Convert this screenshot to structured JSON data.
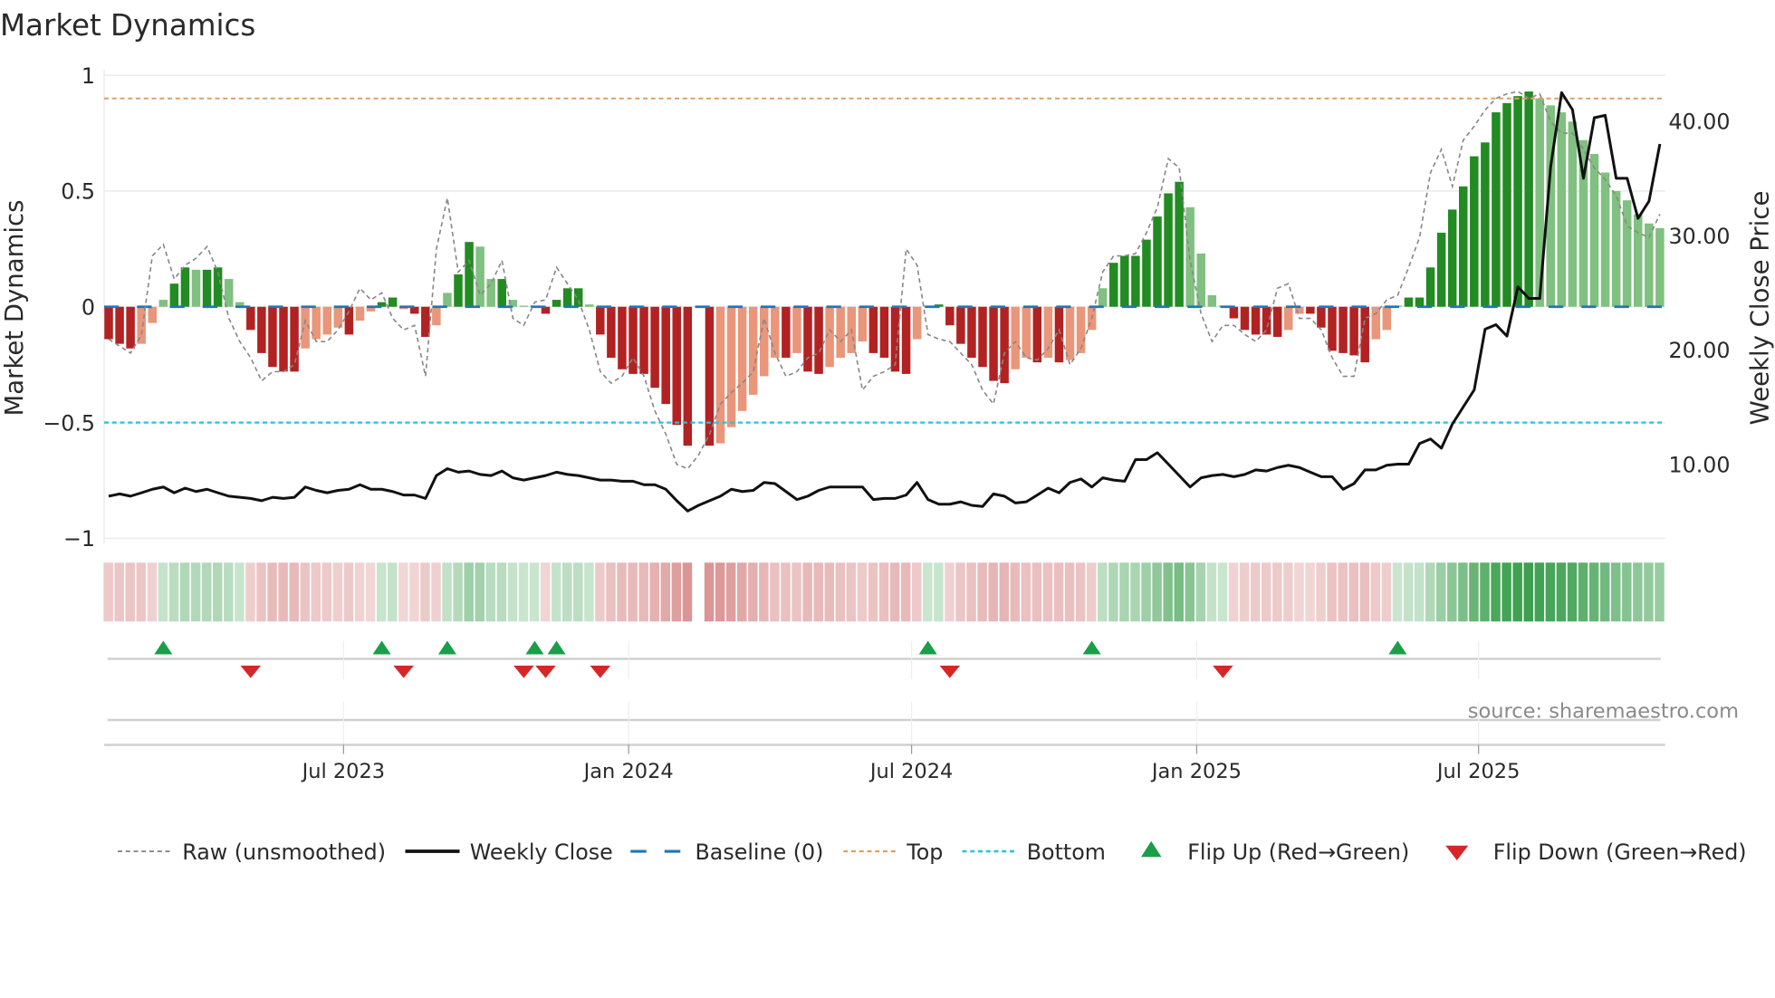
{
  "chart_data": {
    "type": "bar",
    "title": "Market Dynamics",
    "ylabel": "Market Dynamics",
    "y2label": "Weekly Close Price",
    "ylim": [
      -1,
      1
    ],
    "y2lim": [
      0,
      40
    ],
    "yticks": [
      {
        "v": 1,
        "label": "1"
      },
      {
        "v": 0.5,
        "label": "0.5"
      },
      {
        "v": 0,
        "label": "0"
      },
      {
        "v": -0.5,
        "label": "−0.5"
      },
      {
        "v": -1,
        "label": "−1"
      }
    ],
    "y2ticks": [
      {
        "v": 40,
        "label": "40.00"
      },
      {
        "v": 30,
        "label": "30.00"
      },
      {
        "v": 20,
        "label": "20.00"
      },
      {
        "v": 10,
        "label": "10.00"
      }
    ],
    "xticks": [
      {
        "week": 21.5,
        "label": "Jul 2023"
      },
      {
        "week": 47.6,
        "label": "Jan 2024"
      },
      {
        "week": 73.5,
        "label": "Jul 2024"
      },
      {
        "week": 99.6,
        "label": "Jan 2025"
      },
      {
        "week": 125.4,
        "label": "Jul 2025"
      }
    ],
    "weeks": 143,
    "top": 0.9,
    "bottom": -0.5,
    "baseline": 0,
    "bars": [
      -0.14,
      -0.16,
      -0.18,
      -0.16,
      -0.07,
      0.03,
      0.1,
      0.17,
      0.16,
      0.16,
      0.17,
      0.12,
      0.02,
      -0.1,
      -0.2,
      -0.26,
      -0.28,
      -0.28,
      -0.18,
      -0.14,
      -0.12,
      -0.09,
      -0.12,
      -0.06,
      -0.02,
      0.02,
      0.04,
      -0.01,
      -0.03,
      -0.13,
      -0.08,
      0.06,
      0.14,
      0.28,
      0.26,
      0.12,
      0.12,
      0.03,
      0.005,
      0.005,
      -0.03,
      0.03,
      0.08,
      0.08,
      0.01,
      -0.12,
      -0.22,
      -0.27,
      -0.29,
      -0.29,
      -0.35,
      -0.42,
      -0.51,
      -0.6,
      null,
      -0.6,
      -0.59,
      -0.52,
      -0.45,
      -0.38,
      -0.3,
      -0.22,
      -0.22,
      -0.2,
      -0.28,
      -0.29,
      -0.26,
      -0.22,
      -0.2,
      -0.15,
      -0.2,
      -0.22,
      -0.28,
      -0.29,
      -0.14,
      0.005,
      0.01,
      -0.08,
      -0.16,
      -0.22,
      -0.26,
      -0.32,
      -0.33,
      -0.27,
      -0.22,
      -0.24,
      -0.22,
      -0.24,
      -0.23,
      -0.2,
      -0.1,
      0.08,
      0.19,
      0.22,
      0.22,
      0.29,
      0.39,
      0.49,
      0.54,
      0.43,
      0.23,
      0.05,
      0.005,
      -0.05,
      -0.1,
      -0.12,
      -0.12,
      -0.13,
      -0.1,
      -0.03,
      -0.03,
      -0.09,
      -0.19,
      -0.2,
      -0.21,
      -0.24,
      -0.14,
      -0.1,
      0.005,
      0.04,
      0.04,
      0.17,
      0.32,
      0.42,
      0.52,
      0.65,
      0.71,
      0.84,
      0.88,
      0.91,
      0.93,
      0.9,
      0.87,
      0.84,
      0.8,
      0.72,
      0.66,
      0.58,
      0.5,
      0.46,
      0.4,
      0.36,
      0.34
    ],
    "raw": [
      -0.14,
      -0.17,
      -0.2,
      -0.12,
      0.22,
      0.27,
      0.12,
      0.18,
      0.21,
      0.26,
      0.15,
      -0.05,
      -0.15,
      -0.22,
      -0.32,
      -0.28,
      -0.28,
      -0.25,
      -0.06,
      -0.15,
      -0.15,
      -0.1,
      -0.02,
      0.08,
      0.03,
      0.06,
      -0.05,
      -0.1,
      -0.08,
      -0.3,
      0.25,
      0.47,
      0.15,
      0.2,
      0.05,
      0.1,
      0.2,
      -0.05,
      -0.08,
      0.02,
      0.03,
      0.17,
      0.1,
      0.03,
      -0.1,
      -0.28,
      -0.33,
      -0.3,
      -0.22,
      -0.3,
      -0.45,
      -0.55,
      -0.68,
      -0.7,
      -0.64,
      -0.55,
      -0.42,
      -0.37,
      -0.33,
      -0.28,
      -0.05,
      -0.2,
      -0.3,
      -0.28,
      -0.22,
      -0.2,
      -0.1,
      -0.15,
      -0.1,
      -0.36,
      -0.3,
      -0.28,
      -0.25,
      0.25,
      0.18,
      -0.12,
      -0.14,
      -0.15,
      -0.2,
      -0.25,
      -0.36,
      -0.42,
      -0.2,
      -0.15,
      -0.22,
      -0.23,
      -0.18,
      -0.1,
      -0.25,
      -0.18,
      -0.05,
      0.15,
      0.22,
      0.22,
      0.23,
      0.32,
      0.43,
      0.64,
      0.6,
      0.2,
      -0.03,
      -0.15,
      -0.08,
      -0.08,
      -0.12,
      -0.15,
      -0.1,
      0.08,
      0.1,
      -0.05,
      -0.05,
      -0.1,
      -0.22,
      -0.3,
      -0.3,
      -0.05,
      -0.03,
      0.03,
      0.05,
      0.17,
      0.3,
      0.58,
      0.68,
      0.52,
      0.72,
      0.78,
      0.85,
      0.9,
      0.92,
      0.93,
      0.9,
      0.92,
      0.8,
      0.75,
      0.75,
      0.68,
      0.6,
      0.55,
      0.48,
      0.35,
      0.32,
      0.3,
      0.4
    ],
    "close": [
      7.2,
      7.4,
      7.2,
      7.5,
      7.8,
      8.0,
      7.5,
      7.9,
      7.6,
      7.8,
      7.5,
      7.2,
      7.1,
      7.0,
      6.8,
      7.1,
      7.0,
      7.1,
      8.0,
      7.7,
      7.5,
      7.7,
      7.8,
      8.2,
      7.8,
      7.8,
      7.6,
      7.3,
      7.3,
      7.0,
      9.0,
      9.6,
      9.3,
      9.4,
      9.1,
      9.0,
      9.4,
      8.8,
      8.6,
      8.8,
      9.0,
      9.3,
      9.1,
      9.0,
      8.8,
      8.6,
      8.6,
      8.5,
      8.5,
      8.2,
      8.2,
      7.8,
      6.8,
      5.9,
      6.4,
      6.8,
      7.2,
      7.8,
      7.6,
      7.7,
      8.4,
      8.3,
      7.6,
      6.9,
      7.2,
      7.7,
      8.0,
      8.0,
      8.0,
      8.0,
      6.9,
      7.0,
      7.0,
      7.3,
      8.4,
      6.9,
      6.5,
      6.5,
      6.7,
      6.4,
      6.3,
      7.4,
      7.2,
      6.6,
      6.7,
      7.3,
      7.9,
      7.5,
      8.4,
      8.7,
      8.0,
      8.8,
      8.6,
      8.5,
      10.4,
      10.4,
      11.0,
      10.0,
      9.0,
      8.0,
      8.8,
      9.0,
      9.1,
      8.9,
      9.1,
      9.5,
      9.4,
      9.7,
      9.9,
      9.7,
      9.3,
      8.9,
      8.9,
      7.8,
      8.3,
      9.5,
      9.5,
      9.9,
      10.0,
      10.0,
      11.8,
      12.2,
      11.4,
      13.5,
      15.0,
      16.5,
      21.8,
      22.2,
      21.2,
      25.5,
      24.5,
      24.5,
      36.0,
      42.5,
      41.0,
      35.0,
      40.3,
      40.5,
      35.0,
      35.0,
      31.5,
      33.0,
      38.0
    ],
    "flip_up_weeks": [
      5,
      25,
      31,
      39,
      41,
      75,
      90,
      118
    ],
    "flip_down_weeks": [
      13,
      27,
      38,
      40,
      45,
      77,
      102
    ],
    "legend": [
      {
        "key": "raw",
        "label": "Raw (unsmoothed)"
      },
      {
        "key": "close",
        "label": "Weekly Close"
      },
      {
        "key": "baseline",
        "label": "Baseline (0)"
      },
      {
        "key": "top",
        "label": "Top"
      },
      {
        "key": "bottom",
        "label": "Bottom"
      },
      {
        "key": "up",
        "label": "Flip Up (Red→Green)"
      },
      {
        "key": "down",
        "label": "Flip Down (Green→Red)"
      }
    ],
    "legend_position": "bottom",
    "source": "source: sharemaestro.com",
    "colors": {
      "green_dark": "#228b22",
      "green_light": "#80c080",
      "red_dark": "#b22222",
      "red_light": "#e9967a",
      "baseline": "#1f77b4",
      "top": "#e0a060",
      "bottom": "#22c5d8",
      "close": "#111111",
      "raw": "#888888",
      "flip_up": "#1a9e4a",
      "flip_down": "#d62728"
    }
  }
}
